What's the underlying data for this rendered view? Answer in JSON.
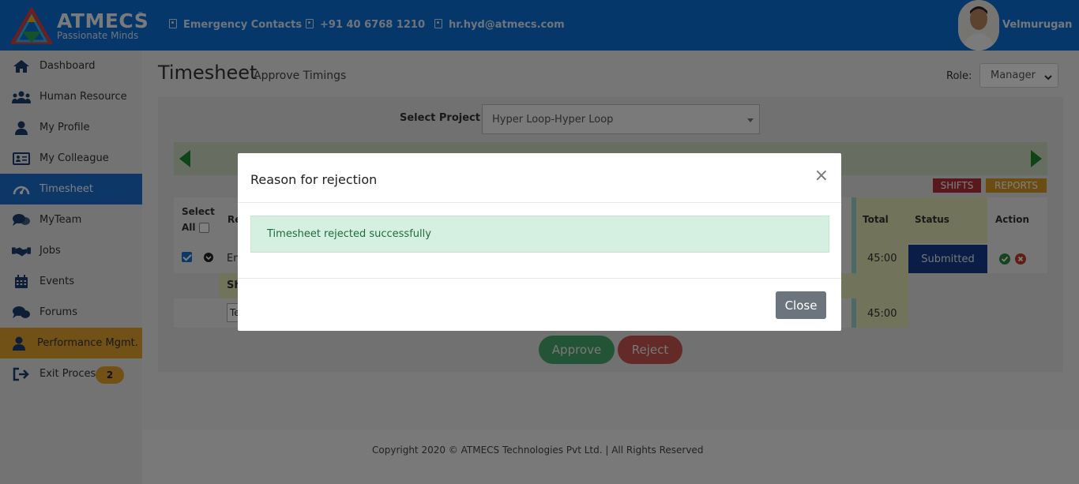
{
  "brand": {
    "name": "ATMECS",
    "tm": "™",
    "tagline": "Passionate Minds"
  },
  "header": {
    "contacts": [
      {
        "label": "Emergency Contacts"
      },
      {
        "label": "+91 40 6768 1210"
      },
      {
        "label": "hr.hyd@atmecs.com"
      }
    ],
    "user_name": "Velmurugan"
  },
  "sidebar": {
    "items": [
      {
        "label": "Dashboard",
        "icon": "home-icon"
      },
      {
        "label": "Human Resource",
        "icon": "people-icon"
      },
      {
        "label": "My Profile",
        "icon": "user-icon"
      },
      {
        "label": "My Colleague",
        "icon": "id-card-icon"
      },
      {
        "label": "Timesheet",
        "icon": "gauge-icon"
      },
      {
        "label": "MyTeam",
        "icon": "chat-icon"
      },
      {
        "label": "Jobs",
        "icon": "handshake-icon"
      },
      {
        "label": "Events",
        "icon": "calendar-icon"
      },
      {
        "label": "Forums",
        "icon": "comments-icon"
      },
      {
        "label": "Performance Mgmt.",
        "icon": "user-icon"
      },
      {
        "label": "Exit Process",
        "icon": "sign-out-icon",
        "badge": "2"
      }
    ]
  },
  "page": {
    "title": "Timesheet",
    "subtitle": "Approve Timings",
    "role_label": "Role:",
    "role_value": "Manager",
    "project_label": "Select Project",
    "project_value": "Hyper Loop-Hyper Loop",
    "shifts_label": "SHIFTS",
    "reports_label": "REPORTS"
  },
  "table": {
    "select_header": "Select",
    "all_label": "All",
    "total_header": "Total",
    "status_header": "Status",
    "action_header": "Action",
    "row_total": "45:00",
    "row_status": "Submitted",
    "summary_total": "45:00"
  },
  "actions": {
    "approve": "Approve",
    "reject": "Reject"
  },
  "footer": {
    "copyright": "Copyright 2020 © ATMECS Technologies Pvt Ltd. | All Rights Reserved"
  },
  "modal": {
    "title": "Reason for rejection",
    "close_icon": "×",
    "message": "Timesheet rejected successfully",
    "close_button": "Close"
  },
  "colors": {
    "header_bg": "#0b6fd6",
    "active_item": "#1b6fce",
    "performance_item": "#e2a32b",
    "status_badge": "#133b8c",
    "success_alert": "#d5f0e1",
    "approve": "#46a86a",
    "reject": "#c9544f"
  }
}
